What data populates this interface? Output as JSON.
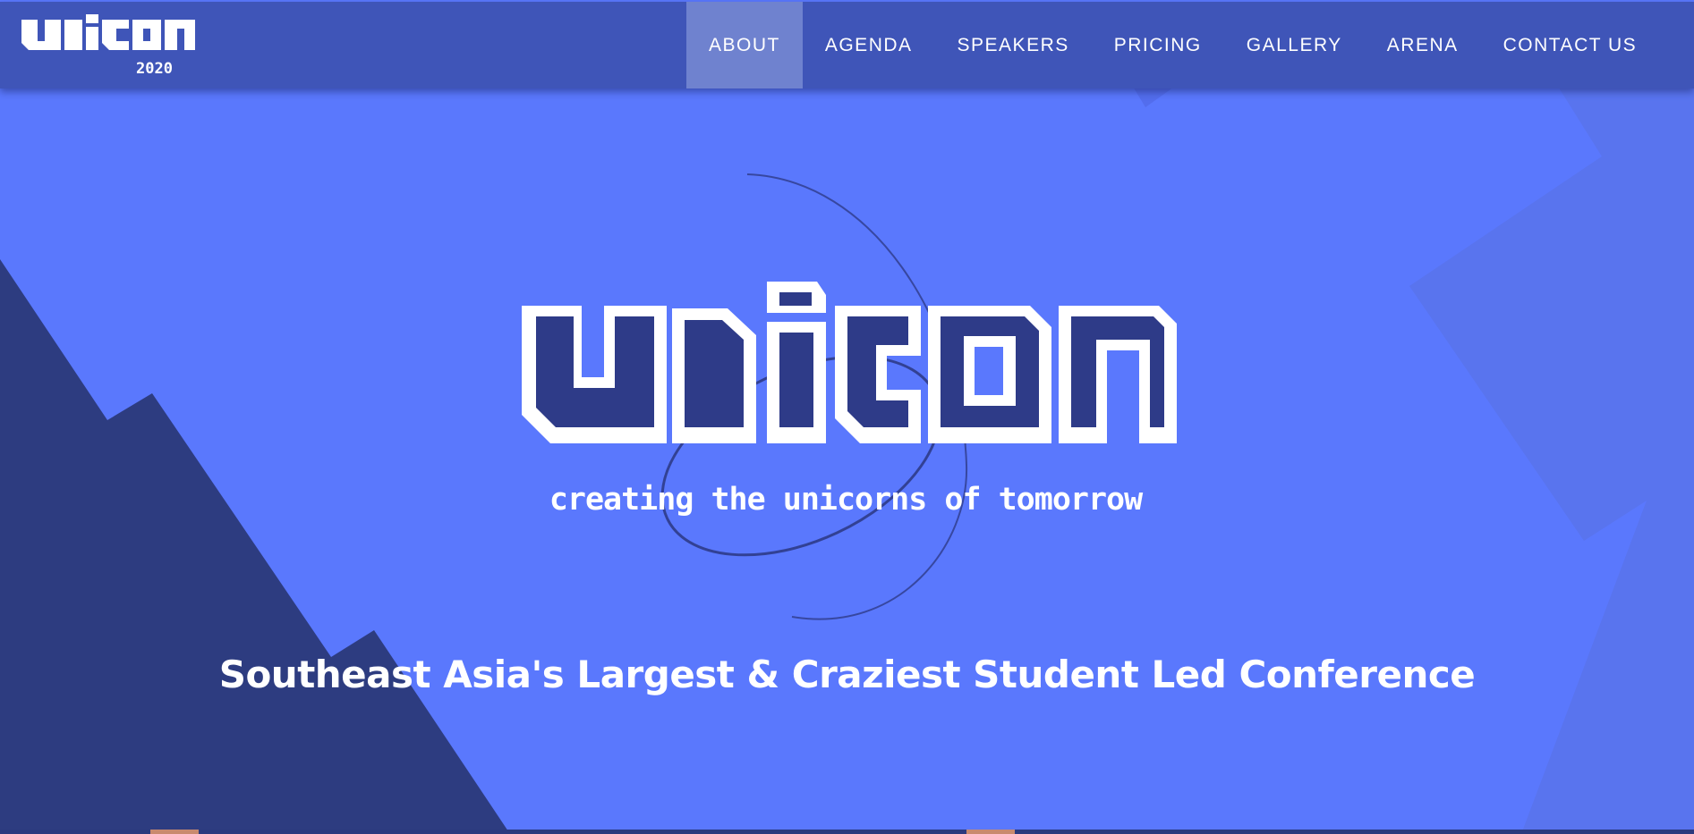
{
  "header": {
    "logo": {
      "name": "unicon",
      "year": "2020"
    },
    "nav": [
      {
        "label": "ABOUT",
        "active": true
      },
      {
        "label": "AGENDA",
        "active": false
      },
      {
        "label": "SPEAKERS",
        "active": false
      },
      {
        "label": "PRICING",
        "active": false
      },
      {
        "label": "GALLERY",
        "active": false
      },
      {
        "label": "ARENA",
        "active": false
      },
      {
        "label": "CONTACT US",
        "active": false
      }
    ]
  },
  "hero": {
    "logo_text": "unicon",
    "tagline": "creating the unicorns of tomorrow",
    "headline": "Southeast Asia's Largest & Craziest Student Led Conference"
  },
  "colors": {
    "background": "#5a78fd",
    "navbar": "#3f55b8",
    "nav_active": "#6f82cf",
    "logo_fill": "#2e3b88",
    "dark_shape": "#2d3c80",
    "text": "#ffffff"
  }
}
